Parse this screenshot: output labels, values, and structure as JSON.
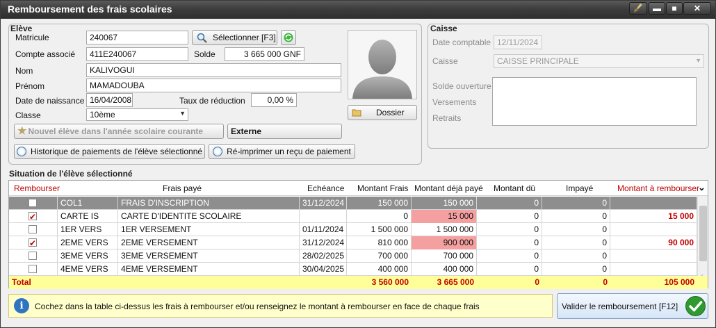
{
  "window": {
    "title": "Remboursement des frais scolaires"
  },
  "eleve": {
    "group_title": "Elève",
    "matricule_label": "Matricule",
    "matricule": "240067",
    "select_button": "Sélectionner [F3]",
    "compte_label": "Compte associé",
    "compte": "411E240067",
    "solde_label": "Solde",
    "solde": "3 665 000 GNF",
    "nom_label": "Nom",
    "nom": "KALIVOGUI",
    "prenom_label": "Prénom",
    "prenom": "MAMADOUBA",
    "naissance_label": "Date de naissance",
    "naissance": "16/04/2008",
    "taux_label": "Taux de réduction",
    "taux": "0,00 %",
    "classe_label": "Classe",
    "classe": "10ème",
    "new_student_button": "Nouvel élève dans l'année scolaire courante",
    "status_button": "Externe",
    "history_button": "Historique de paiements de l'élève sélectionné",
    "reprint_button": "Ré-imprimer un reçu de paiement",
    "dossier_button": "Dossier"
  },
  "caisse": {
    "group_title": "Caisse",
    "date_label": "Date comptable",
    "date": "12/11/2024",
    "caisse_label": "Caisse",
    "caisse": "CAISSE PRINCIPALE",
    "solde_ouverture_label": "Solde ouverture",
    "versements_label": "Versements",
    "retraits_label": "Retraits"
  },
  "situation": {
    "title": "Situation de l'élève sélectionné",
    "columns": [
      "Rembourser",
      "Frais payé",
      "Echéance",
      "Montant Frais",
      "Montant déjà payé",
      "Montant dû",
      "Impayé",
      "Montant à rembourser"
    ],
    "rows": [
      {
        "checked": false,
        "code": "COL1",
        "label": "FRAIS D'INSCRIPTION",
        "echeance": "31/12/2024",
        "frais": "150 000",
        "paye": "150 000",
        "du": "0",
        "impaye": "0",
        "rembourser": ""
      },
      {
        "checked": true,
        "code": "CARTE IS",
        "label": "CARTE D'IDENTITE SCOLAIRE",
        "echeance": "",
        "frais": "0",
        "paye": "15 000",
        "du": "0",
        "impaye": "0",
        "rembourser": "15 000"
      },
      {
        "checked": false,
        "code": "1ER VERS",
        "label": "1ER VERSEMENT",
        "echeance": "01/11/2024",
        "frais": "1 500 000",
        "paye": "1 500 000",
        "du": "0",
        "impaye": "0",
        "rembourser": ""
      },
      {
        "checked": true,
        "code": "2EME VERS",
        "label": "2EME VERSEMENT",
        "echeance": "31/12/2024",
        "frais": "810 000",
        "paye": "900 000",
        "du": "0",
        "impaye": "0",
        "rembourser": "90 000"
      },
      {
        "checked": false,
        "code": "3EME VERS",
        "label": "3EME VERSEMENT",
        "echeance": "28/02/2025",
        "frais": "700 000",
        "paye": "700 000",
        "du": "0",
        "impaye": "0",
        "rembourser": ""
      },
      {
        "checked": false,
        "code": "4EME VERS",
        "label": "4EME VERSEMENT",
        "echeance": "30/04/2025",
        "frais": "400 000",
        "paye": "400 000",
        "du": "0",
        "impaye": "0",
        "rembourser": ""
      }
    ],
    "total": {
      "label": "Total",
      "frais": "3 560 000",
      "paye": "3 665 000",
      "du": "0",
      "impaye": "0",
      "rembourser": "105 000"
    }
  },
  "footer": {
    "info": "Cochez dans la table ci-dessus les frais à rembourser et/ou renseignez le montant à rembourser en face de chaque frais",
    "validate_button": "Valider le remboursement [F12]"
  },
  "colors": {
    "accent_red": "#c00000",
    "paid_highlight": "#f4a0a0",
    "total_bg": "#ffff99",
    "selected_row": "#8e8e8e"
  }
}
